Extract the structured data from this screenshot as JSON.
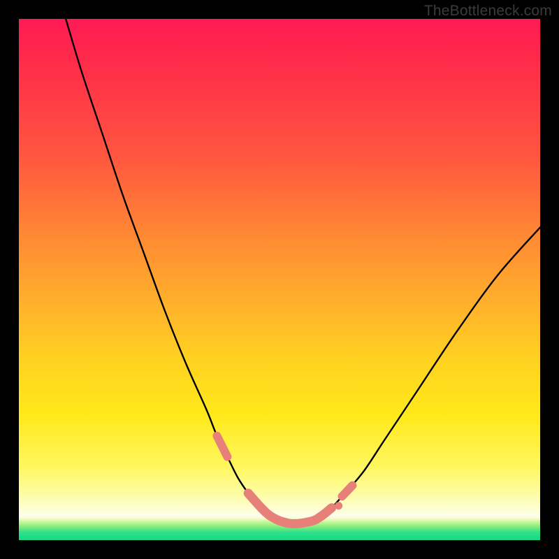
{
  "watermark": "TheBottleneck.com",
  "chart_data": {
    "type": "line",
    "title": "",
    "xlabel": "",
    "ylabel": "",
    "xlim": [
      0,
      100
    ],
    "ylim": [
      0,
      100
    ],
    "grid": false,
    "legend": false,
    "series": [
      {
        "name": "bottleneck-curve",
        "x": [
          9,
          12,
          16,
          20,
          24,
          28,
          32,
          36,
          38,
          40,
          42,
          44,
          46,
          48,
          50,
          52,
          54,
          56,
          58,
          60,
          62,
          66,
          70,
          76,
          84,
          92,
          100
        ],
        "y": [
          100,
          90,
          78,
          66,
          55,
          44,
          34,
          25,
          20,
          16,
          12,
          9,
          6.5,
          4.8,
          3.6,
          3.2,
          3.2,
          3.6,
          4.6,
          6.2,
          8.4,
          13,
          19,
          28,
          40,
          51,
          60
        ],
        "color": "#000000"
      }
    ],
    "annotations": [
      {
        "name": "valley-highlight",
        "type": "segment-overlay",
        "color": "#e68079",
        "x": [
          38,
          40,
          44,
          48,
          52,
          56,
          58,
          60,
          62,
          64
        ],
        "y": [
          20,
          16,
          9,
          4.8,
          3.2,
          3.6,
          4.6,
          6.2,
          8.4,
          10.5
        ]
      }
    ]
  }
}
